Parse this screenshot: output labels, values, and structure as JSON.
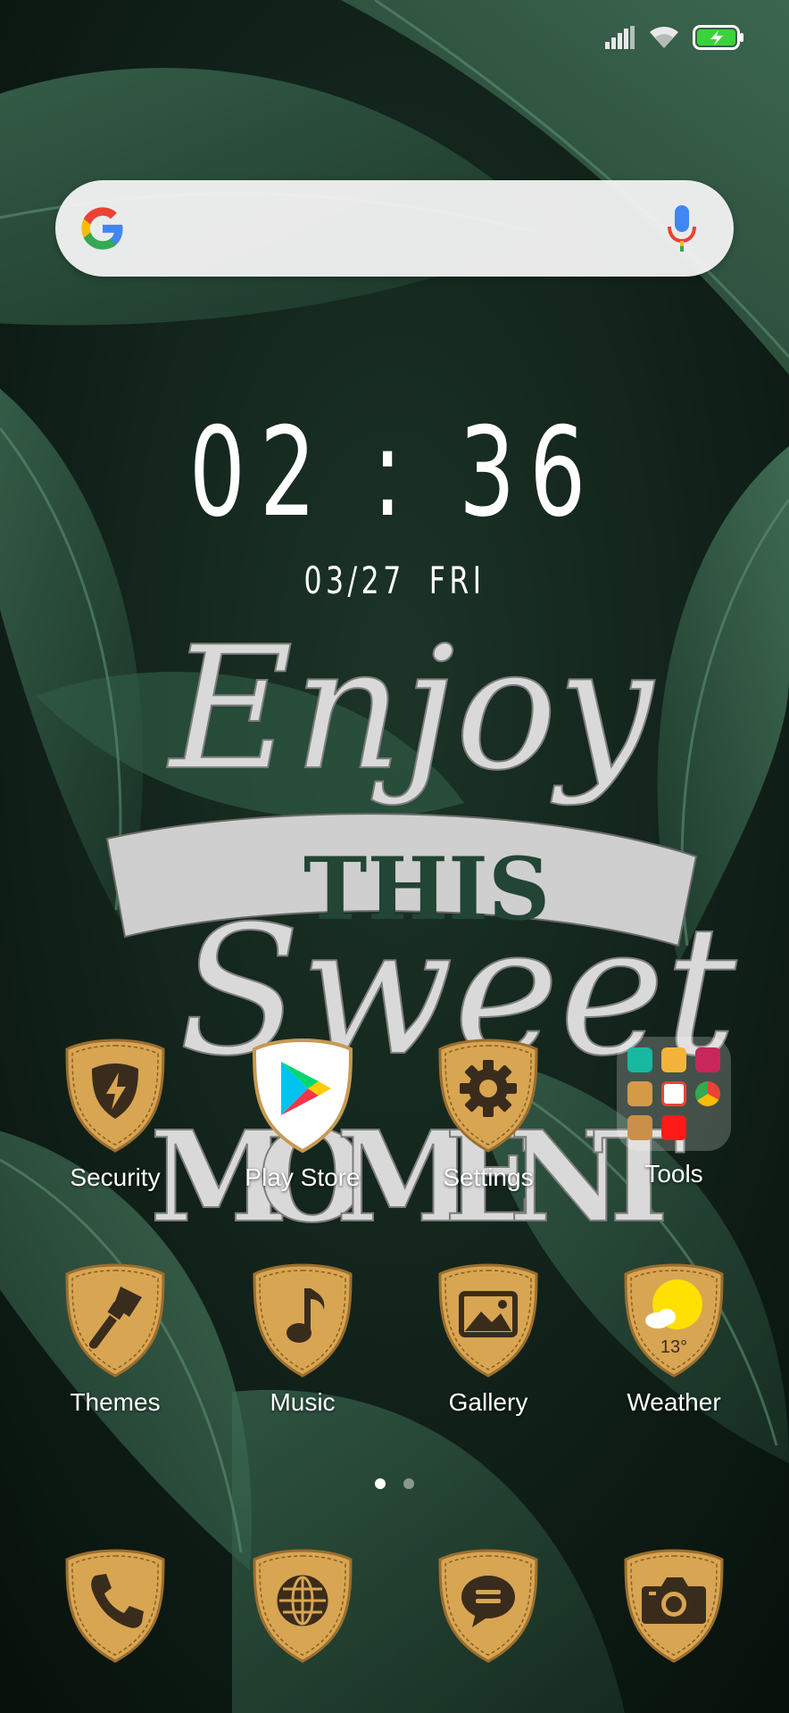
{
  "status_bar": {
    "signal_icon": "signal-bars-icon",
    "wifi_icon": "wifi-icon",
    "battery_icon": "battery-charging-icon",
    "battery_color": "#3ad33a"
  },
  "search_bar": {
    "logo_icon": "google-g-icon",
    "mic_icon": "microphone-icon"
  },
  "clock": {
    "time": "02 : 36",
    "date": "03/27",
    "weekday": "FRI"
  },
  "wallpaper": {
    "quote_line1": "Enjoy",
    "quote_line2": "THIS",
    "quote_line3": "Sweet",
    "quote_line4": "MOMENT"
  },
  "apps_row1": [
    {
      "label": "Security",
      "icon": "lightning-shield-icon"
    },
    {
      "label": "Play Store",
      "icon": "play-store-icon"
    },
    {
      "label": "Settings",
      "icon": "gear-icon"
    },
    {
      "label": "Tools",
      "icon": "folder-icon"
    }
  ],
  "apps_row2": [
    {
      "label": "Themes",
      "icon": "paintbrush-icon"
    },
    {
      "label": "Music",
      "icon": "music-note-icon"
    },
    {
      "label": "Gallery",
      "icon": "image-icon"
    },
    {
      "label": "Weather",
      "icon": "sun-cloud-icon",
      "temperature": "13°"
    }
  ],
  "dock": [
    {
      "icon": "phone-icon"
    },
    {
      "icon": "globe-icon"
    },
    {
      "icon": "chat-bubble-icon"
    },
    {
      "icon": "camera-icon"
    }
  ],
  "page_indicator": {
    "pages": 2,
    "active": 1
  },
  "colors": {
    "shield_gold": "#d8a552",
    "shield_dark": "#a87a35",
    "glyph": "#3a2c1c"
  }
}
